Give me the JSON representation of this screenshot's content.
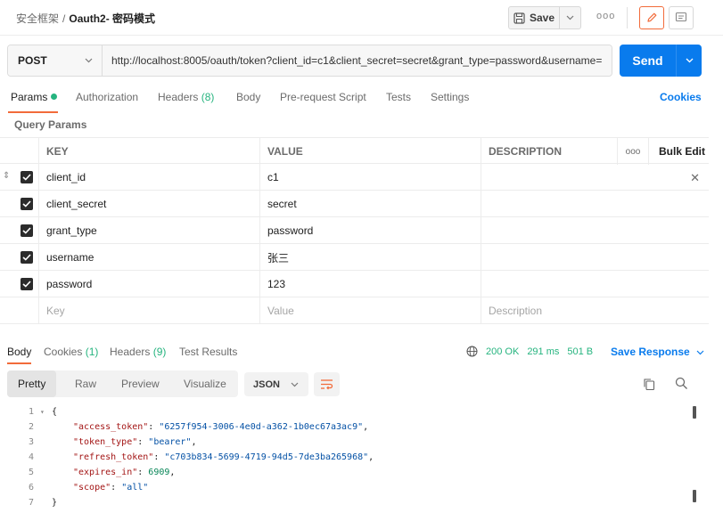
{
  "header": {
    "breadcrumb_parent": "安全框架",
    "breadcrumb_sep": "/",
    "breadcrumb_current": "Oauth2- 密码模式",
    "save_label": "Save",
    "more_label": "ooo"
  },
  "request": {
    "method": "POST",
    "url": "http://localhost:8005/oauth/token?client_id=c1&client_secret=secret&grant_type=password&username=",
    "send_label": "Send"
  },
  "req_tabs": {
    "params": "Params",
    "authorization": "Authorization",
    "headers": "Headers",
    "headers_count": "(8)",
    "body": "Body",
    "prerequest": "Pre-request Script",
    "tests": "Tests",
    "settings": "Settings",
    "cookies": "Cookies"
  },
  "query_params": {
    "title": "Query Params",
    "columns": {
      "key": "KEY",
      "value": "VALUE",
      "description": "DESCRIPTION",
      "more": "ooo",
      "bulk": "Bulk Edit"
    },
    "rows": [
      {
        "key": "client_id",
        "value": "c1"
      },
      {
        "key": "client_secret",
        "value": "secret"
      },
      {
        "key": "grant_type",
        "value": "password"
      },
      {
        "key": "username",
        "value": "张三"
      },
      {
        "key": "password",
        "value": "123"
      }
    ],
    "placeholders": {
      "key": "Key",
      "value": "Value",
      "description": "Description"
    }
  },
  "response": {
    "tabs": {
      "body": "Body",
      "cookies": "Cookies",
      "cookies_count": "(1)",
      "headers": "Headers",
      "headers_count": "(9)",
      "test_results": "Test Results"
    },
    "status": "200 OK",
    "time": "291 ms",
    "size": "501 B",
    "save_response": "Save Response",
    "views": {
      "pretty": "Pretty",
      "raw": "Raw",
      "preview": "Preview",
      "visualize": "Visualize"
    },
    "format": "JSON",
    "code_lines": [
      {
        "num": "1",
        "text": "{"
      },
      {
        "num": "2",
        "key": "\"access_token\"",
        "value": "\"6257f954-3006-4e0d-a362-1b0ec67a3ac9\"",
        "type": "s"
      },
      {
        "num": "3",
        "key": "\"token_type\"",
        "value": "\"bearer\"",
        "type": "s"
      },
      {
        "num": "4",
        "key": "\"refresh_token\"",
        "value": "\"c703b834-5699-4719-94d5-7de3ba265968\"",
        "type": "s"
      },
      {
        "num": "5",
        "key": "\"expires_in\"",
        "value": "6909",
        "type": "n"
      },
      {
        "num": "6",
        "key": "\"scope\"",
        "value": "\"all\"",
        "type": "s",
        "last": true
      },
      {
        "num": "7",
        "text": "}"
      }
    ]
  },
  "colors": {
    "accent_orange": "#f26b3a",
    "primary_blue": "#097bed",
    "success_green": "#26b47f"
  }
}
